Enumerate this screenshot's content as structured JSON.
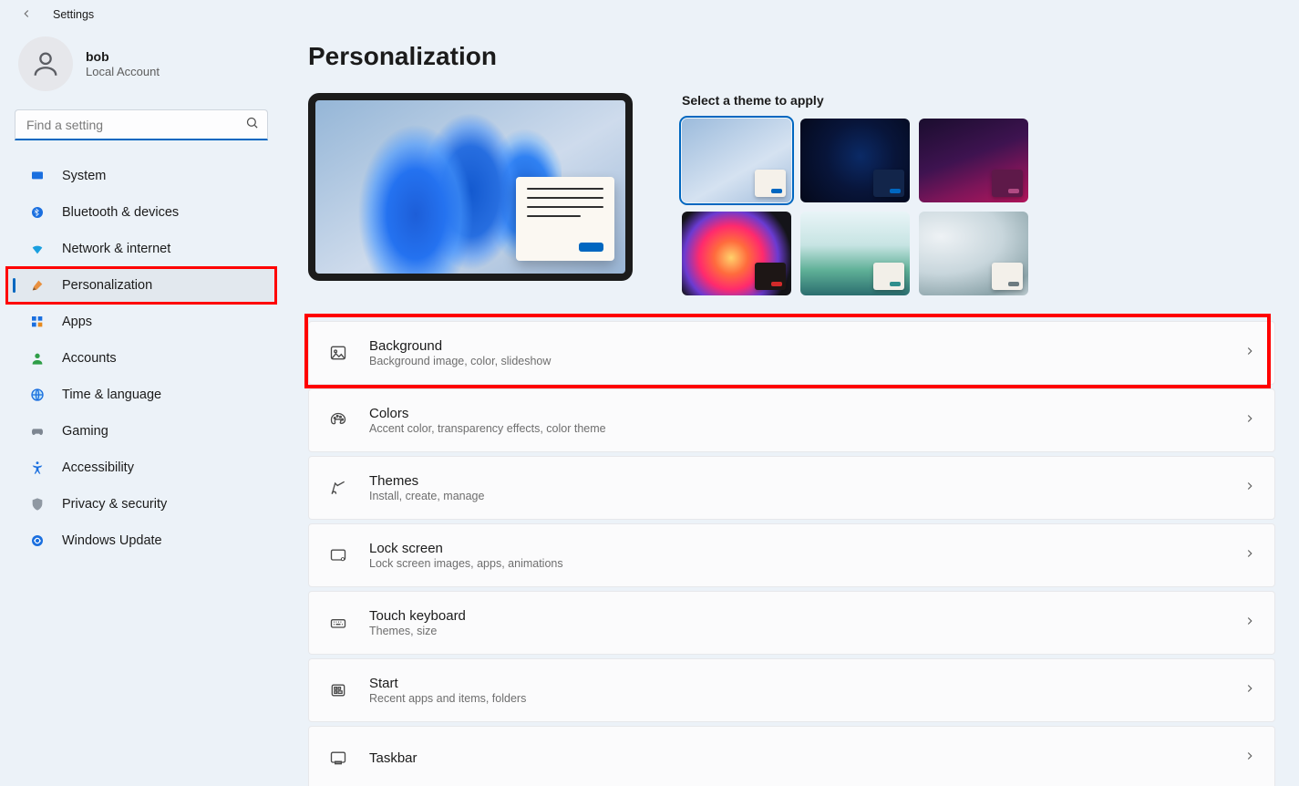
{
  "titlebar": {
    "title": "Settings"
  },
  "profile": {
    "name": "bob",
    "subtitle": "Local Account"
  },
  "search": {
    "placeholder": "Find a setting"
  },
  "sidebar": {
    "items": [
      {
        "label": "System"
      },
      {
        "label": "Bluetooth & devices"
      },
      {
        "label": "Network & internet"
      },
      {
        "label": "Personalization"
      },
      {
        "label": "Apps"
      },
      {
        "label": "Accounts"
      },
      {
        "label": "Time & language"
      },
      {
        "label": "Gaming"
      },
      {
        "label": "Accessibility"
      },
      {
        "label": "Privacy & security"
      },
      {
        "label": "Windows Update"
      }
    ]
  },
  "page": {
    "title": "Personalization",
    "themes_heading": "Select a theme to apply",
    "themes": [
      {
        "id": "light-bloom",
        "bg": "linear-gradient(150deg,#9cbbdc 0%,#d5e2f1 60%,#a2bddc 100%)",
        "accent": "#0067c0",
        "window_bg": "#f5f1ea",
        "selected": true
      },
      {
        "id": "dark-bloom",
        "bg": "radial-gradient(circle at 55% 45%, #0b2a66 0%, #08153a 45%, #040819 100%)",
        "accent": "#0067c0",
        "window_bg": "#12254a",
        "selected": false
      },
      {
        "id": "glow",
        "bg": "linear-gradient(160deg,#1a0d2e 0%, #3e1350 45%, #7d1559 72%, #b2165c 100%)",
        "accent": "#b04a83",
        "window_bg": "#5e1949",
        "selected": false
      },
      {
        "id": "captured-motion",
        "bg": "radial-gradient(circle at 45% 55%, #ffd26b 0%, #ff6b3d 22%, #ff2a6d 42%, #6a3bd1 62%, #141419 80%)",
        "accent": "#d22a2a",
        "window_bg": "#1d1615",
        "selected": false
      },
      {
        "id": "sunrise",
        "bg": "linear-gradient(180deg,#e8f4f7 0%, #c7e4e3 40%, #5fb097 70%, #2b6e6f 100%)",
        "accent": "#2f8e8c",
        "window_bg": "#f2efe8",
        "selected": false
      },
      {
        "id": "flow",
        "bg": "radial-gradient(140% 110% at 20% 30%, #eef2f5 0%, #c8d6dc 40%, #8ca4aa 70%, #e9edf0 100%)",
        "accent": "#6d7b80",
        "window_bg": "#f3f0ea",
        "selected": false
      }
    ],
    "settings": [
      {
        "title": "Background",
        "sub": "Background image, color, slideshow"
      },
      {
        "title": "Colors",
        "sub": "Accent color, transparency effects, color theme"
      },
      {
        "title": "Themes",
        "sub": "Install, create, manage"
      },
      {
        "title": "Lock screen",
        "sub": "Lock screen images, apps, animations"
      },
      {
        "title": "Touch keyboard",
        "sub": "Themes, size"
      },
      {
        "title": "Start",
        "sub": "Recent apps and items, folders"
      },
      {
        "title": "Taskbar",
        "sub": ""
      }
    ]
  }
}
